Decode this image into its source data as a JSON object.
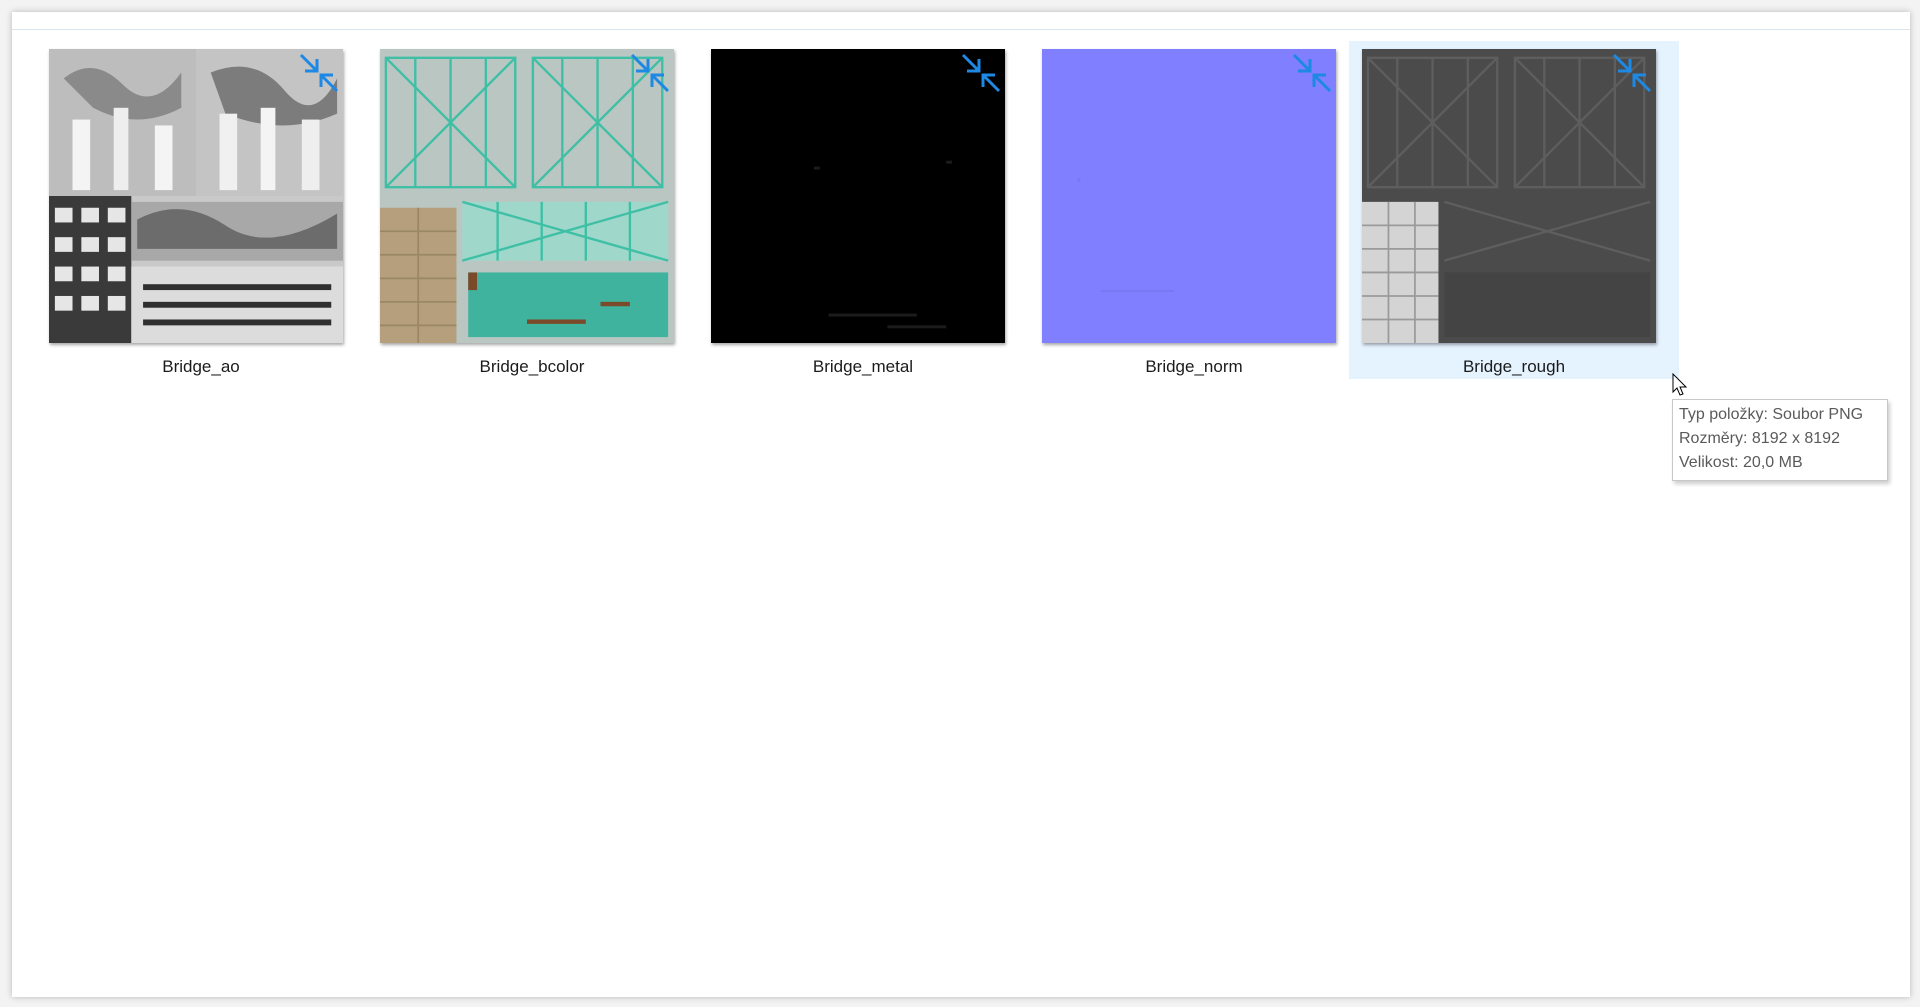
{
  "files": [
    {
      "name": "Bridge_ao",
      "compressed_icon": "compress-arrows-icon"
    },
    {
      "name": "Bridge_bcolor",
      "compressed_icon": "compress-arrows-icon"
    },
    {
      "name": "Bridge_metal",
      "compressed_icon": "compress-arrows-icon"
    },
    {
      "name": "Bridge_norm",
      "compressed_icon": "compress-arrows-icon"
    },
    {
      "name": "Bridge_rough",
      "compressed_icon": "compress-arrows-icon",
      "selected": true
    }
  ],
  "tooltip": {
    "type": "Typ položky: Soubor PNG",
    "dimensions": "Rozměry: 8192 x 8192",
    "size": "Velikost: 20,0 MB"
  },
  "colors": {
    "selection_bg": "#e5f3ff",
    "compress_icon": "#1e88e5",
    "normal_map": "#7f7fff"
  }
}
